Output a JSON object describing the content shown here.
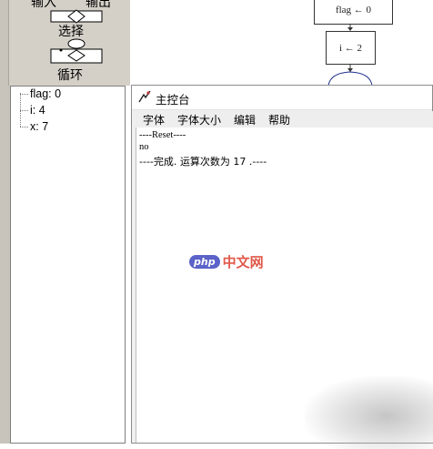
{
  "palette": {
    "io_left_label": "输入",
    "io_right_label": "输出",
    "select_label": "选择",
    "loop_label": "循环"
  },
  "tree": {
    "items": [
      {
        "label": "flag: 0"
      },
      {
        "label": "i: 4"
      },
      {
        "label": "x: 7"
      }
    ]
  },
  "flowchart": {
    "box1": "flag ← 0",
    "box2": "i ← 2"
  },
  "console": {
    "title": "主控台",
    "menu": [
      "字体",
      "字体大小",
      "编辑",
      "帮助"
    ],
    "output": [
      "----Reset----",
      "no",
      "----完成. 运算次数为  17 .----"
    ]
  },
  "watermark": {
    "badge": "php",
    "text": "中文网"
  }
}
